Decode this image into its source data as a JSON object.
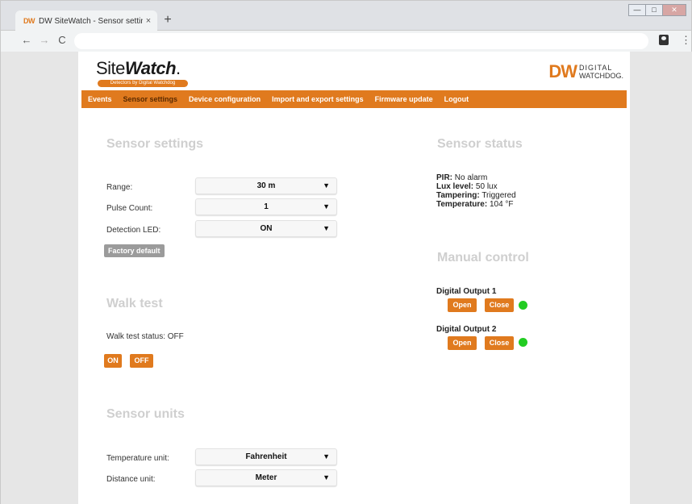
{
  "browser": {
    "tab_favicon": "DW",
    "tab_title": "DW SiteWatch - Sensor settings",
    "tab_close": "×",
    "new_tab": "+",
    "back": "←",
    "forward": "→",
    "reload": "C",
    "address": "",
    "menu": "⋮",
    "window_controls": {
      "minimize": "—",
      "restore": "□",
      "close": "✕"
    }
  },
  "header": {
    "logo_main": "Site",
    "logo_bold": "Watch",
    "logo_tm": ".",
    "logo_tagline": "Detectors by Digital Watchdog",
    "brand_mark": "DW",
    "brand_line1": "DIGITAL",
    "brand_line2": "WATCHDOG."
  },
  "nav": {
    "items": [
      {
        "label": "Events"
      },
      {
        "label": "Sensor settings"
      },
      {
        "label": "Device configuration"
      },
      {
        "label": "Import and export settings"
      },
      {
        "label": "Firmware update"
      },
      {
        "label": "Logout"
      }
    ],
    "active_index": 1
  },
  "sensor_settings": {
    "title": "Sensor settings",
    "range_label": "Range:",
    "range_value": "30 m",
    "pulse_label": "Pulse Count:",
    "pulse_value": "1",
    "led_label": "Detection LED:",
    "led_value": "ON",
    "factory_default": "Factory default",
    "caret": "▼"
  },
  "walk_test": {
    "title": "Walk test",
    "status_text": "Walk test status: OFF",
    "on_label": "ON",
    "off_label": "OFF"
  },
  "sensor_units": {
    "title": "Sensor units",
    "temp_label": "Temperature unit:",
    "temp_value": "Fahrenheit",
    "distance_label": "Distance unit:",
    "distance_value": "Meter"
  },
  "sensor_status": {
    "title": "Sensor status",
    "pir_key": "PIR:",
    "pir_value": " No alarm",
    "lux_key": "Lux level:",
    "lux_value": " 50 lux",
    "tamper_key": "Tampering:",
    "tamper_value": " Triggered",
    "temp_key": "Temperature:",
    "temp_value": " 104 °F"
  },
  "manual_control": {
    "title": "Manual control",
    "output1_label": "Digital Output 1",
    "output2_label": "Digital Output 2",
    "open_label": "Open",
    "close_label": "Close",
    "indicator_color": "#22cc22"
  },
  "colors": {
    "accent": "#e07a1e",
    "title_gray": "#cfcfcf"
  }
}
